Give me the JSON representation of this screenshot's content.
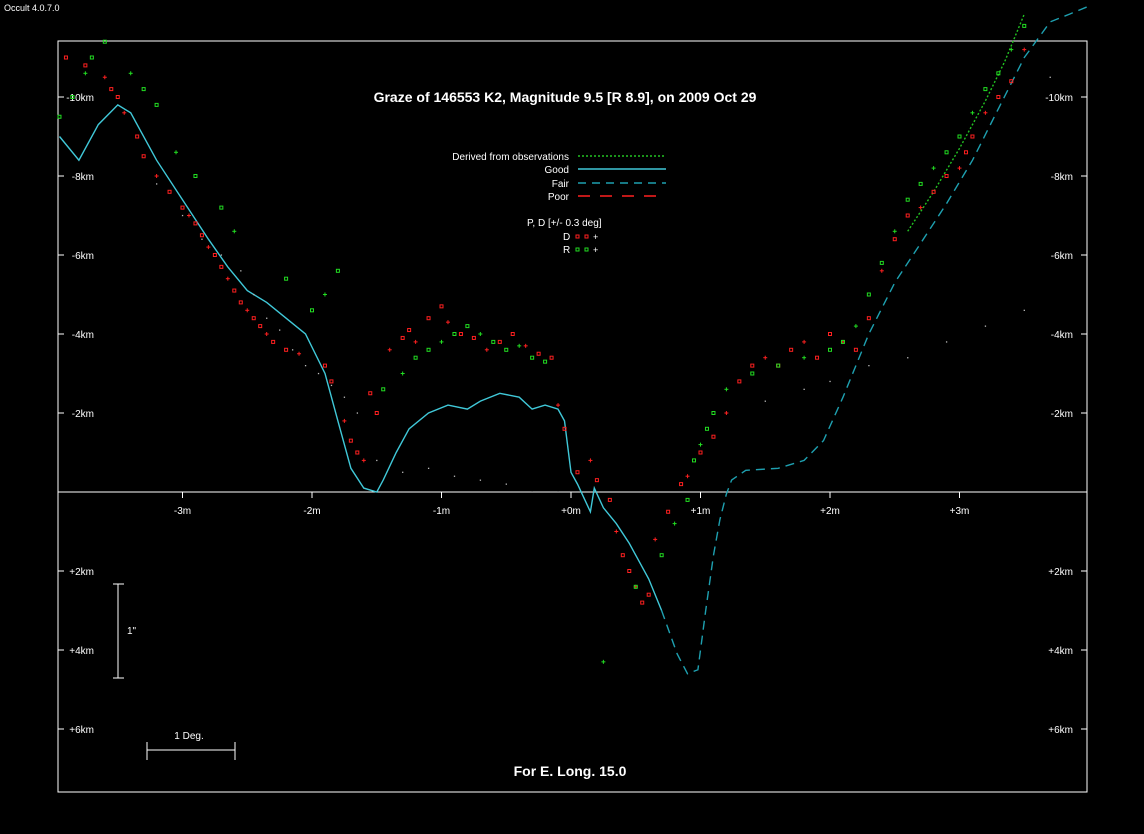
{
  "app": {
    "version_label": "Occult 4.0.7.0"
  },
  "chart_data": {
    "type": "scatter",
    "title": "Graze of  146553 K2,  Magnitude 9.5 [R 8.9],  on 2009 Oct 29",
    "footer": "For E. Long. 15.0",
    "x_units": "m",
    "y_units": "km",
    "xlim": [
      -3.95,
      4.0
    ],
    "ylim": [
      -12.2,
      7.6
    ],
    "x_ticks": [
      {
        "value": -3,
        "label": "-3m"
      },
      {
        "value": -2,
        "label": "-2m"
      },
      {
        "value": -1,
        "label": "-1m"
      },
      {
        "value": 0,
        "label": "+0m"
      },
      {
        "value": 1,
        "label": "+1m"
      },
      {
        "value": 2,
        "label": "+2m"
      },
      {
        "value": 3,
        "label": "+3m"
      }
    ],
    "y_ticks": [
      {
        "value": -10,
        "label": "-10km"
      },
      {
        "value": -8,
        "label": "-8km"
      },
      {
        "value": -6,
        "label": "-6km"
      },
      {
        "value": -4,
        "label": "-4km"
      },
      {
        "value": -2,
        "label": "-2km"
      },
      {
        "value": 2,
        "label": "+2km"
      },
      {
        "value": 4,
        "label": "+4km"
      },
      {
        "value": 6,
        "label": "+6km"
      }
    ],
    "scale_bar_vertical": "1\"",
    "scale_bar_horizontal": "1 Deg.",
    "legend": {
      "lines": [
        {
          "label": "Derived from observations",
          "style": "dotted",
          "color": "#22c222"
        },
        {
          "label": "Good",
          "style": "solid",
          "color": "#40c8d8"
        },
        {
          "label": "Fair",
          "style": "dashed",
          "color": "#1ea0b0"
        },
        {
          "label": "Poor",
          "style": "long-dash",
          "color": "#ff2020"
        }
      ],
      "pd_heading": "P, D [+/- 0.3 deg]",
      "pd_items": [
        {
          "label": "D",
          "color": "#ff2020"
        },
        {
          "label": "R",
          "color": "#22dd22"
        }
      ]
    },
    "series": [
      {
        "name": "Good",
        "style": "solid",
        "color": "#40c8d8",
        "x": [
          -3.95,
          -3.8,
          -3.65,
          -3.5,
          -3.4,
          -3.2,
          -3.0,
          -2.8,
          -2.65,
          -2.5,
          -2.35,
          -2.2,
          -2.05,
          -1.9,
          -1.8,
          -1.7,
          -1.6,
          -1.5,
          -1.45,
          -1.35,
          -1.25,
          -1.1,
          -0.95,
          -0.8,
          -0.7,
          -0.55,
          -0.4,
          -0.3,
          -0.2,
          -0.1,
          -0.05,
          0.0,
          0.05,
          0.15,
          0.18,
          0.25,
          0.35,
          0.45,
          0.6,
          0.7
        ],
        "y": [
          -9.0,
          -8.4,
          -9.3,
          -9.8,
          -9.6,
          -8.4,
          -7.4,
          -6.4,
          -5.7,
          -5.1,
          -4.8,
          -4.4,
          -4.0,
          -3.0,
          -1.8,
          -0.6,
          -0.1,
          0.0,
          -0.3,
          -1.0,
          -1.6,
          -2.0,
          -2.2,
          -2.1,
          -2.3,
          -2.5,
          -2.4,
          -2.1,
          -2.2,
          -2.1,
          -1.8,
          -0.5,
          -0.2,
          0.5,
          -0.1,
          0.4,
          0.8,
          1.3,
          2.2,
          3.0
        ]
      },
      {
        "name": "Fair",
        "style": "dashed",
        "color": "#1ea0b0",
        "x": [
          0.7,
          0.82,
          0.9,
          0.98,
          1.04,
          1.1,
          1.15,
          1.2,
          1.24,
          1.35,
          1.6,
          1.8,
          1.95,
          2.1,
          2.3,
          2.5,
          2.7,
          2.9,
          3.1,
          3.3,
          3.5,
          3.7,
          3.85,
          4.0
        ],
        "y": [
          3.0,
          4.1,
          4.6,
          4.5,
          3.0,
          1.6,
          0.7,
          0.05,
          -0.3,
          -0.55,
          -0.6,
          -0.8,
          -1.3,
          -2.4,
          -4.0,
          -5.3,
          -6.3,
          -7.3,
          -8.4,
          -9.7,
          -11.0,
          -11.9,
          -12.1,
          -12.3
        ]
      },
      {
        "name": "Derived from observations",
        "style": "dotted",
        "color": "#22c222",
        "x": [
          2.6,
          2.8,
          3.0,
          3.2,
          3.35,
          3.5
        ],
        "y": [
          -6.6,
          -7.6,
          -8.7,
          -9.9,
          -10.9,
          -12.1
        ]
      },
      {
        "name": "Limb",
        "style": "dots",
        "color": "#bbbbbb",
        "x": [
          -3.2,
          -3.0,
          -2.85,
          -2.7,
          -2.55,
          -2.45,
          -2.35,
          -2.25,
          -2.15,
          -2.05,
          -1.95,
          -1.85,
          -1.75,
          -1.65,
          -1.5,
          -1.3,
          -1.1,
          -0.9,
          -0.7,
          -0.5,
          -0.3,
          -0.1,
          1.2,
          1.5,
          1.8,
          2.0,
          2.3,
          2.6,
          2.9,
          3.2,
          3.5,
          3.7
        ],
        "y": [
          -7.8,
          -7.0,
          -6.4,
          -6.0,
          -5.6,
          -5.0,
          -4.4,
          -4.1,
          -3.6,
          -3.2,
          -3.0,
          -2.7,
          -2.4,
          -2.0,
          -0.8,
          -0.5,
          -0.6,
          -0.4,
          -0.3,
          -0.2,
          0.0,
          0.0,
          -2.0,
          -2.3,
          -2.6,
          -2.8,
          -3.2,
          -3.4,
          -3.8,
          -4.2,
          -4.6,
          -10.5
        ]
      },
      {
        "name": "D",
        "style": "markers",
        "color": "#ff2020",
        "x": [
          -3.9,
          -3.75,
          -3.6,
          -3.55,
          -3.5,
          -3.45,
          -3.35,
          -3.3,
          -3.2,
          -3.1,
          -3.0,
          -2.95,
          -2.9,
          -2.85,
          -2.8,
          -2.75,
          -2.7,
          -2.65,
          -2.6,
          -2.55,
          -2.5,
          -2.45,
          -2.4,
          -2.35,
          -2.3,
          -2.2,
          -2.1,
          -1.9,
          -1.85,
          -1.75,
          -1.7,
          -1.65,
          -1.6,
          -1.55,
          -1.5,
          -1.4,
          -1.3,
          -1.25,
          -1.2,
          -1.1,
          -1.0,
          -0.95,
          -0.85,
          -0.75,
          -0.65,
          -0.55,
          -0.45,
          -0.35,
          -0.25,
          -0.15,
          -0.1,
          -0.05,
          0.05,
          0.15,
          0.2,
          0.3,
          0.35,
          0.4,
          0.45,
          0.5,
          0.55,
          0.6,
          0.65,
          0.75,
          0.85,
          0.9,
          1.0,
          1.1,
          1.2,
          1.3,
          1.4,
          1.5,
          1.6,
          1.7,
          1.8,
          1.9,
          2.0,
          2.1,
          2.2,
          2.3,
          2.4,
          2.5,
          2.6,
          2.7,
          2.8,
          2.9,
          3.0,
          3.05,
          3.1,
          3.2,
          3.3,
          3.4,
          3.5
        ],
        "y": [
          -11.0,
          -10.8,
          -10.5,
          -10.2,
          -10.0,
          -9.6,
          -9.0,
          -8.5,
          -8.0,
          -7.6,
          -7.2,
          -7.0,
          -6.8,
          -6.5,
          -6.2,
          -6.0,
          -5.7,
          -5.4,
          -5.1,
          -4.8,
          -4.6,
          -4.4,
          -4.2,
          -4.0,
          -3.8,
          -3.6,
          -3.5,
          -3.2,
          -2.8,
          -1.8,
          -1.3,
          -1.0,
          -0.8,
          -2.5,
          -2.0,
          -3.6,
          -3.9,
          -4.1,
          -3.8,
          -4.4,
          -4.7,
          -4.3,
          -4.0,
          -3.9,
          -3.6,
          -3.8,
          -4.0,
          -3.7,
          -3.5,
          -3.4,
          -2.2,
          -1.6,
          -0.5,
          -0.8,
          -0.3,
          0.2,
          1.0,
          1.6,
          2.0,
          2.4,
          2.8,
          2.6,
          1.2,
          0.5,
          -0.2,
          -0.4,
          -1.0,
          -1.4,
          -2.0,
          -2.8,
          -3.2,
          -3.4,
          -3.2,
          -3.6,
          -3.8,
          -3.4,
          -4.0,
          -3.8,
          -3.6,
          -4.4,
          -5.6,
          -6.4,
          -7.0,
          -7.2,
          -7.6,
          -8.0,
          -8.2,
          -8.6,
          -9.0,
          -9.6,
          -10.0,
          -10.4,
          -11.2
        ]
      },
      {
        "name": "R",
        "style": "markers",
        "color": "#22dd22",
        "x": [
          -3.95,
          -3.85,
          -3.75,
          -3.7,
          -3.6,
          -3.4,
          -3.3,
          -3.2,
          -3.05,
          -2.9,
          -2.7,
          -2.6,
          -2.2,
          -2.0,
          -1.9,
          -1.8,
          -1.45,
          -1.3,
          -1.2,
          -1.1,
          -1.0,
          -0.9,
          -0.8,
          -0.7,
          -0.6,
          -0.5,
          -0.4,
          -0.3,
          -0.2,
          0.25,
          0.5,
          0.7,
          0.8,
          0.9,
          0.95,
          1.0,
          1.05,
          1.1,
          1.2,
          1.4,
          1.6,
          1.8,
          2.0,
          2.1,
          2.2,
          2.3,
          2.4,
          2.5,
          2.6,
          2.7,
          2.8,
          2.9,
          3.0,
          3.1,
          3.2,
          3.3,
          3.4,
          3.5
        ],
        "y": [
          -9.5,
          -10.0,
          -10.6,
          -11.0,
          -11.4,
          -10.6,
          -10.2,
          -9.8,
          -8.6,
          -8.0,
          -7.2,
          -6.6,
          -5.4,
          -4.6,
          -5.0,
          -5.6,
          -2.6,
          -3.0,
          -3.4,
          -3.6,
          -3.8,
          -4.0,
          -4.2,
          -4.0,
          -3.8,
          -3.6,
          -3.7,
          -3.4,
          -3.3,
          4.3,
          2.4,
          1.6,
          0.8,
          0.2,
          -0.8,
          -1.2,
          -1.6,
          -2.0,
          -2.6,
          -3.0,
          -3.2,
          -3.4,
          -3.6,
          -3.8,
          -4.2,
          -5.0,
          -5.8,
          -6.6,
          -7.4,
          -7.8,
          -8.2,
          -8.6,
          -9.0,
          -9.6,
          -10.2,
          -10.6,
          -11.2,
          -11.8
        ]
      }
    ]
  }
}
